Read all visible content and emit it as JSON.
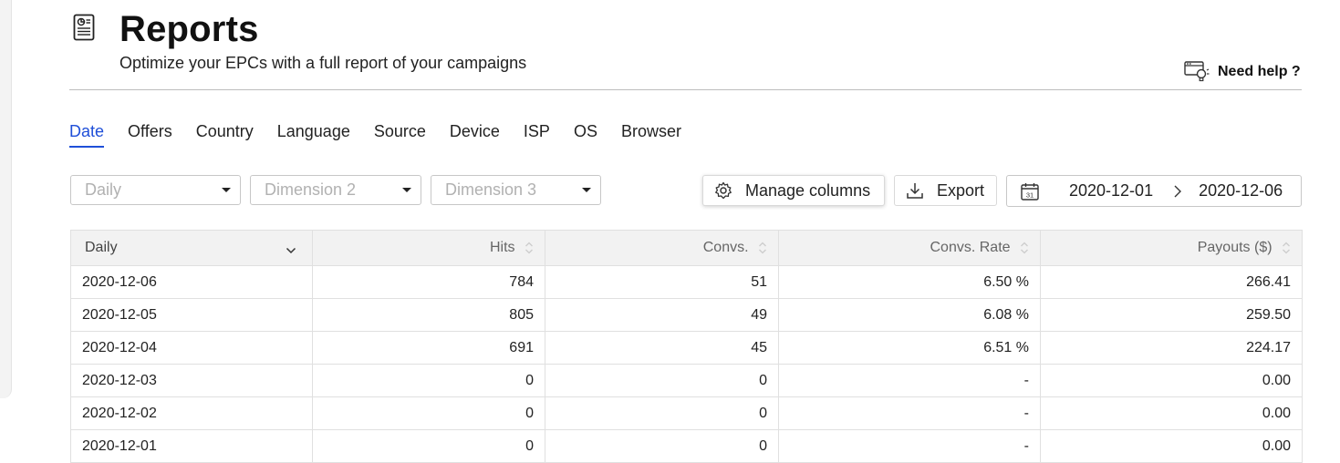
{
  "header": {
    "title": "Reports",
    "subtitle": "Optimize your EPCs with a full report of your campaigns",
    "help_label": "Need help ?"
  },
  "tabs": [
    {
      "label": "Date",
      "active": true
    },
    {
      "label": "Offers"
    },
    {
      "label": "Country"
    },
    {
      "label": "Language"
    },
    {
      "label": "Source"
    },
    {
      "label": "Device"
    },
    {
      "label": "ISP"
    },
    {
      "label": "OS"
    },
    {
      "label": "Browser"
    }
  ],
  "filters": {
    "dimension1": "Daily",
    "dimension2": "Dimension 2",
    "dimension3": "Dimension 3"
  },
  "toolbar": {
    "manage_columns": "Manage columns",
    "export": "Export"
  },
  "date_range": {
    "start": "2020-12-01",
    "end": "2020-12-06",
    "calendar_icon_text": "31"
  },
  "table": {
    "columns": [
      "Daily",
      "Hits",
      "Convs.",
      "Convs. Rate",
      "Payouts ($)"
    ],
    "rows": [
      [
        "2020-12-06",
        "784",
        "51",
        "6.50 %",
        "266.41"
      ],
      [
        "2020-12-05",
        "805",
        "49",
        "6.08 %",
        "259.50"
      ],
      [
        "2020-12-04",
        "691",
        "45",
        "6.51 %",
        "224.17"
      ],
      [
        "2020-12-03",
        "0",
        "0",
        "-",
        "0.00"
      ],
      [
        "2020-12-02",
        "0",
        "0",
        "-",
        "0.00"
      ],
      [
        "2020-12-01",
        "0",
        "0",
        "-",
        "0.00"
      ]
    ]
  },
  "colors": {
    "accent": "#1f4fd8",
    "header_bg": "#f2f2f2"
  },
  "icons": [
    "report-icon",
    "help-lightbulb-icon",
    "gear-icon",
    "download-icon",
    "calendar-icon",
    "chevron-right-icon",
    "caret-down-icon",
    "sort-icon"
  ]
}
